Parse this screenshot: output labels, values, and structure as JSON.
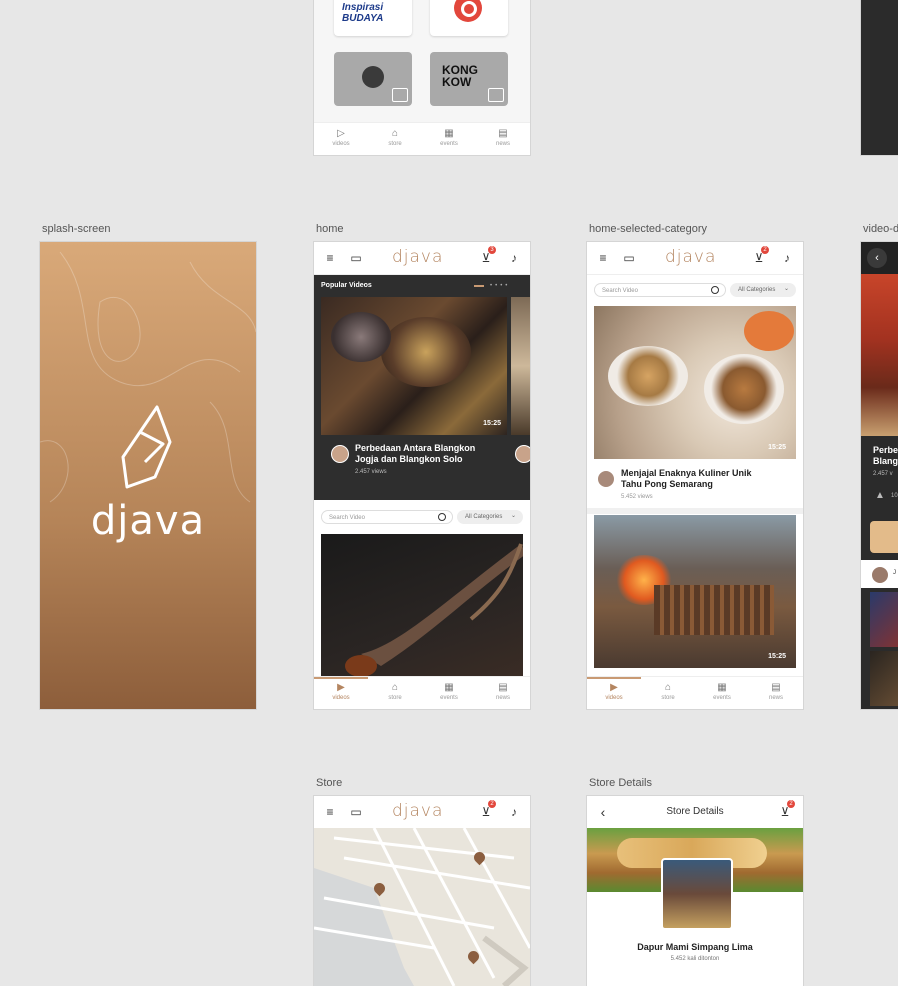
{
  "artboards": {
    "splash": "splash-screen",
    "home": "home",
    "home_selected": "home-selected-category",
    "video_detail": "video-d",
    "store": "Store",
    "store_details": "Store Details"
  },
  "brand": "djava",
  "top_partial": {
    "logos": [
      "Inspirasi BUDAYA",
      "",
      "",
      "KONG KOW"
    ]
  },
  "tabs": [
    "videos",
    "store",
    "events",
    "news"
  ],
  "home": {
    "section_title": "Popular Videos",
    "featured_title": "Perbedaan Antara Blangkon Jogja dan Blangkon Solo",
    "featured_views": "2.457 views",
    "featured_duration": "15:25",
    "search_placeholder": "Search Video",
    "category": "All Categories",
    "cart_count": "3"
  },
  "home_selected": {
    "search_placeholder": "Search Video",
    "category": "All Categories",
    "cart_count": "2",
    "video1_title": "Menjajal Enaknya Kuliner Unik Tahu Pong Semarang",
    "video1_views": "5.452 views",
    "video1_duration": "15:25",
    "video2_duration": "15:25"
  },
  "video_detail": {
    "title_part": "Perbe Blang",
    "views_part": "2.457 v",
    "likes_part": "10",
    "user_part": "J"
  },
  "store": {
    "cart_count": "2"
  },
  "store_details": {
    "title": "Store Details",
    "cart_count": "2",
    "store_name": "Dapur Mami Simpang Lima",
    "visits": "5.452 kali ditonton"
  },
  "colors": {
    "accent": "#b48560",
    "dark": "#2e2e2e",
    "badge": "#e2473c"
  }
}
